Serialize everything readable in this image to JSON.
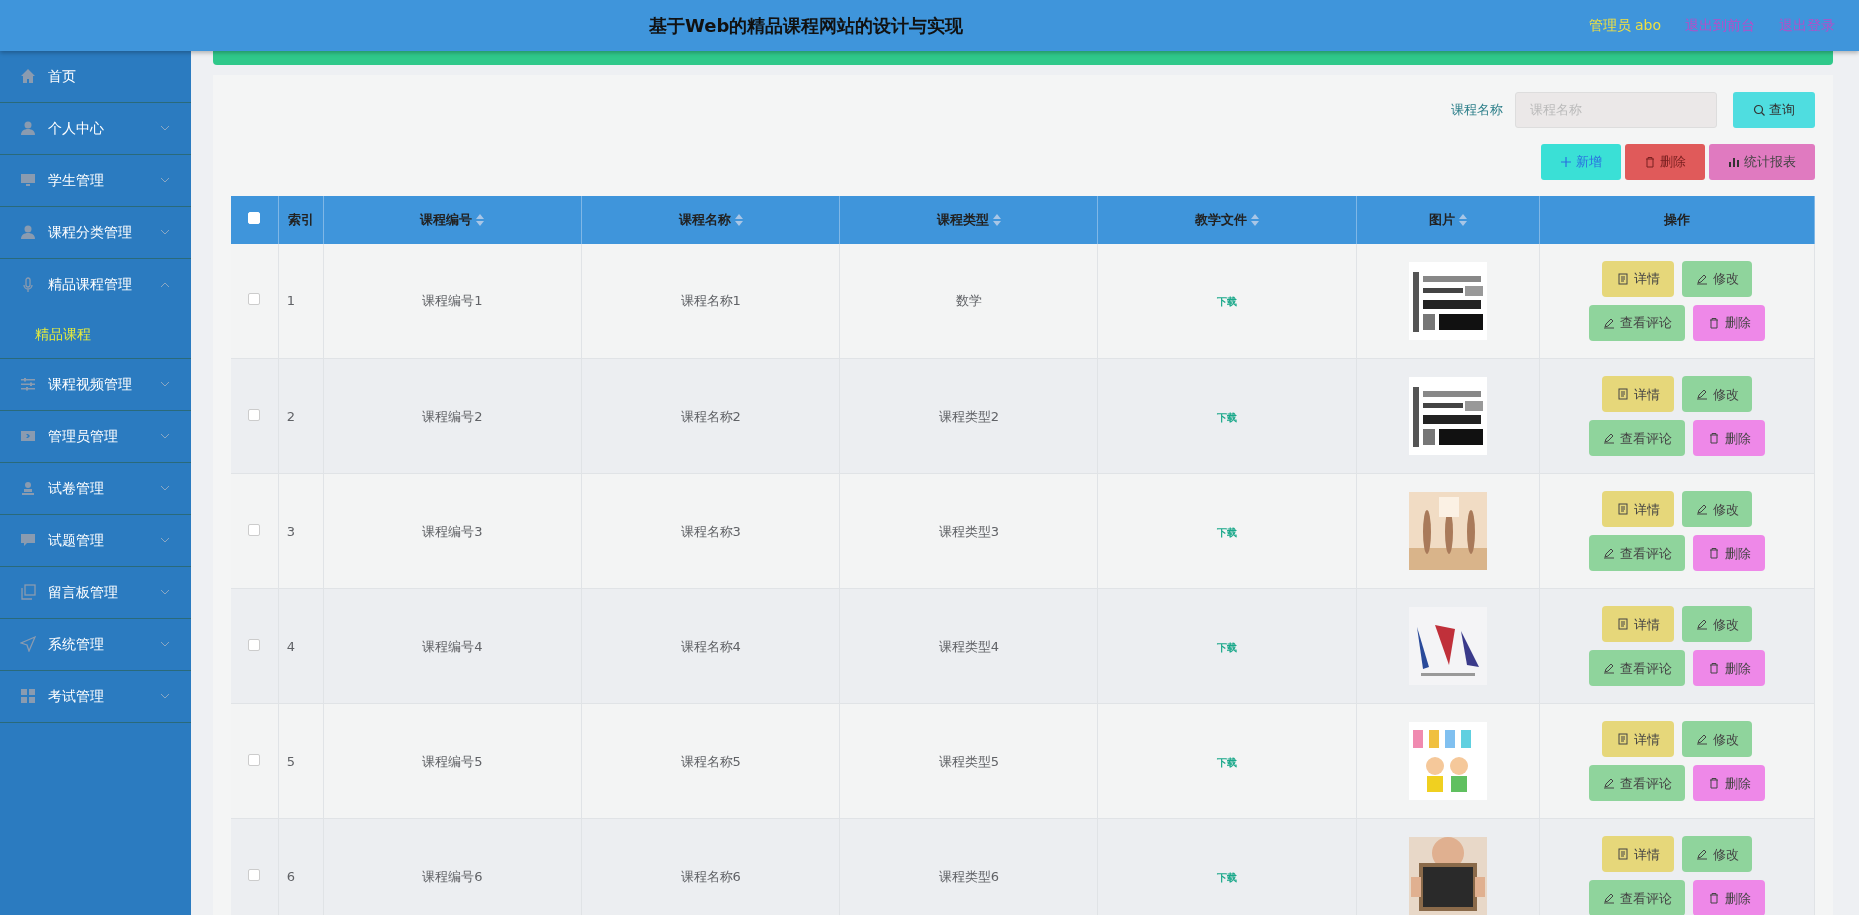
{
  "header": {
    "title": "基于Web的精品课程网站的设计与实现",
    "user": "管理员 abo",
    "links": [
      "退出到前台",
      "退出登录"
    ]
  },
  "sidebar": {
    "items": [
      {
        "label": "首页"
      },
      {
        "label": "个人中心",
        "expanded": false
      },
      {
        "label": "学生管理",
        "expanded": false
      },
      {
        "label": "课程分类管理",
        "expanded": false
      },
      {
        "label": "精品课程管理",
        "expanded": true,
        "children": [
          {
            "label": "精品课程",
            "selected": true
          }
        ]
      },
      {
        "label": "课程视频管理",
        "expanded": false
      },
      {
        "label": "管理员管理",
        "expanded": false
      },
      {
        "label": "试卷管理",
        "expanded": false
      },
      {
        "label": "试题管理",
        "expanded": false
      },
      {
        "label": "留言板管理",
        "expanded": false
      },
      {
        "label": "系统管理",
        "expanded": false
      },
      {
        "label": "考试管理",
        "expanded": false
      }
    ]
  },
  "search": {
    "label": "课程名称",
    "placeholder": "课程名称",
    "button": "查询"
  },
  "toolbar": [
    {
      "kind": "add",
      "label": "新增"
    },
    {
      "kind": "delete",
      "label": "删除"
    },
    {
      "kind": "report",
      "label": "统计报表"
    }
  ],
  "table": {
    "select_all": false,
    "columns": [
      {
        "label": "索引",
        "sortable": false
      },
      {
        "label": "课程编号",
        "sortable": true
      },
      {
        "label": "课程名称",
        "sortable": true
      },
      {
        "label": "课程类型",
        "sortable": true
      },
      {
        "label": "教学文件",
        "sortable": true
      },
      {
        "label": "图片",
        "sortable": true
      },
      {
        "label": "操作",
        "sortable": false
      }
    ],
    "rows": [
      {
        "selected": false,
        "index": "1",
        "code": "课程编号1",
        "name": "课程名称1",
        "type": "数学",
        "file": "下载",
        "actions": [
          "详情",
          "修改",
          "查看评论",
          "删除"
        ]
      },
      {
        "selected": false,
        "index": "2",
        "code": "课程编号2",
        "name": "课程名称2",
        "type": "课程类型2",
        "file": "下载",
        "actions": [
          "详情",
          "修改",
          "查看评论",
          "删除"
        ]
      },
      {
        "selected": false,
        "index": "3",
        "code": "课程编号3",
        "name": "课程名称3",
        "type": "课程类型3",
        "file": "下载",
        "actions": [
          "详情",
          "修改",
          "查看评论",
          "删除"
        ]
      },
      {
        "selected": false,
        "index": "4",
        "code": "课程编号4",
        "name": "课程名称4",
        "type": "课程类型4",
        "file": "下载",
        "actions": [
          "详情",
          "修改",
          "查看评论",
          "删除"
        ]
      },
      {
        "selected": false,
        "index": "5",
        "code": "课程编号5",
        "name": "课程名称5",
        "type": "课程类型5",
        "file": "下载",
        "actions": [
          "详情",
          "修改",
          "查看评论",
          "删除"
        ]
      },
      {
        "selected": false,
        "index": "6",
        "code": "课程编号6",
        "name": "课程名称6",
        "type": "课程类型6",
        "file": "下载",
        "actions": [
          "详情",
          "修改",
          "查看评论",
          "删除"
        ]
      }
    ]
  }
}
